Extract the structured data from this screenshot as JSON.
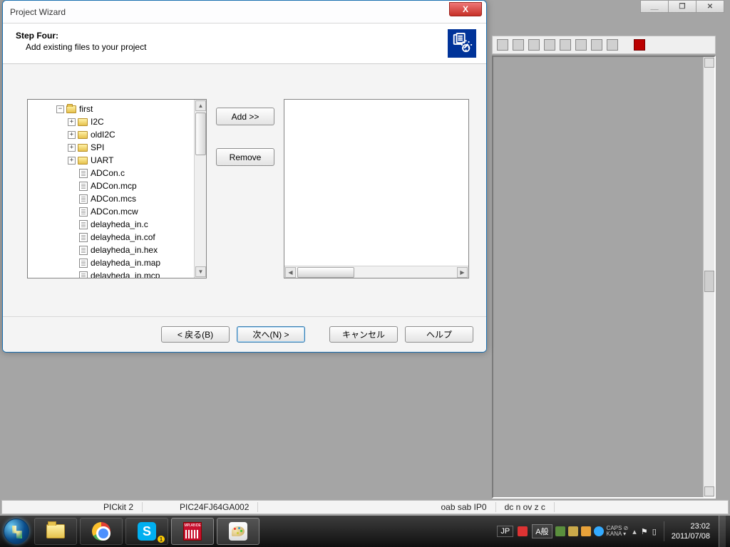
{
  "dialog": {
    "title": "Project Wizard",
    "step_label": "Step Four:",
    "step_sub": "Add existing files to your project",
    "add_label": "Add >>",
    "remove_label": "Remove",
    "back_label": "< 戻る(B)",
    "next_label": "次へ(N) >",
    "cancel_label": "キャンセル",
    "help_label": "ヘルプ",
    "tree": {
      "root": "first",
      "folders": [
        "I2C",
        "oldI2C",
        "SPI",
        "UART"
      ],
      "files": [
        "ADCon.c",
        "ADCon.mcp",
        "ADCon.mcs",
        "ADCon.mcw",
        "delayheda_in.c",
        "delayheda_in.cof",
        "delayheda_in.hex",
        "delayheda_in.map",
        "delayheda_in.mcp"
      ]
    }
  },
  "statusbar": {
    "tool": "PICkit 2",
    "device": "PIC24FJ64GA002",
    "bank": "oab sab IP0",
    "flags": "dc n ov z c"
  },
  "tray": {
    "lang": "JP",
    "ime": "A般",
    "caps": "CAPS",
    "kana": "KANA",
    "time": "23:02",
    "date": "2011/07/08"
  }
}
